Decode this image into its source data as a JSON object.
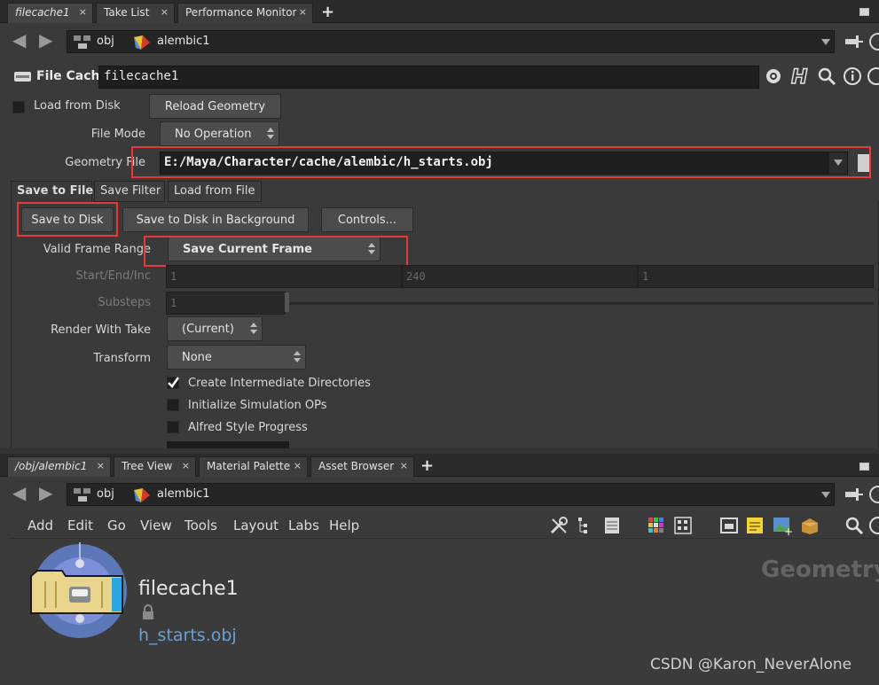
{
  "top_tabs": [
    {
      "label": "filecache1"
    },
    {
      "label": "Take List"
    },
    {
      "label": "Performance Monitor"
    }
  ],
  "path": {
    "crumbs": [
      "obj",
      "alembic1"
    ]
  },
  "node": {
    "type_label": "File Cache",
    "name": "filecache1"
  },
  "params": {
    "load_from_disk": "Load from Disk",
    "reload_geometry": "Reload Geometry",
    "file_mode_label": "File Mode",
    "file_mode_value": "No Operation",
    "geometry_file_label": "Geometry File",
    "geometry_file_value": "E:/Maya/Character/cache/alembic/h_starts.obj"
  },
  "sub_tabs": [
    {
      "label": "Save to File"
    },
    {
      "label": "Save Filter"
    },
    {
      "label": "Load from File"
    }
  ],
  "save": {
    "save_to_disk": "Save to Disk",
    "save_bg": "Save to Disk in Background",
    "controls": "Controls...",
    "valid_range_label": "Valid Frame Range",
    "valid_range_value": "Save Current Frame",
    "start_end_label": "Start/End/Inc",
    "start": "1",
    "end": "240",
    "inc": "1",
    "substeps_label": "Substeps",
    "substeps": "1",
    "render_take_label": "Render With Take",
    "render_take_value": "(Current)",
    "transform_label": "Transform",
    "transform_value": "None",
    "create_dirs": "Create Intermediate Directories",
    "create_dirs_checked": true,
    "init_sim": "Initialize Simulation OPs",
    "alfred": "Alfred Style Progress"
  },
  "bottom_tabs": [
    {
      "label": "/obj/alembic1"
    },
    {
      "label": "Tree View"
    },
    {
      "label": "Material Palette"
    },
    {
      "label": "Asset Browser"
    }
  ],
  "menu": [
    "Add",
    "Edit",
    "Go",
    "View",
    "Tools",
    "Layout",
    "Labs",
    "Help"
  ],
  "network": {
    "node_name": "filecache1",
    "node_file": "h_starts.obj",
    "context_label": "Geometry"
  },
  "watermark": "CSDN @Karon_NeverAlone",
  "colors": {
    "highlight": "#e5393a",
    "node_file": "#6b9fd6",
    "node_body": "#e8d48a"
  }
}
